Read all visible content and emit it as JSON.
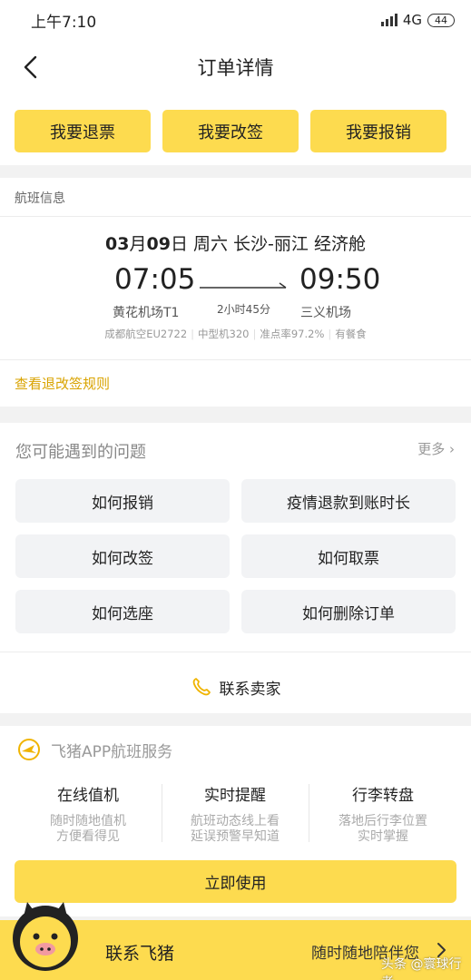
{
  "status_bar": {
    "time": "上午7:10",
    "network": "4G",
    "battery": "44",
    "icons": [
      "signal-icon",
      "battery-icon"
    ]
  },
  "nav": {
    "title": "订单详情",
    "back_icon": "chevron-left-icon"
  },
  "actions": [
    {
      "label": "我要退票"
    },
    {
      "label": "我要改签"
    },
    {
      "label": "我要报销"
    }
  ],
  "flight": {
    "section_label": "航班信息",
    "date_month": "03",
    "month_unit": "月",
    "date_day": "09",
    "day_unit": "日",
    "summary": "周六 长沙-丽江 经济舱",
    "depart_time": "07:05",
    "arrive_time": "09:50",
    "duration": "2小时45分",
    "depart_airport": "黄花机场T1",
    "arrive_airport": "三义机场",
    "meta": [
      "成都航空EU2722",
      "中型机320",
      "准点率97.2%",
      "有餐食"
    ],
    "rules_link": "查看退改签规则"
  },
  "faq": {
    "title": "您可能遇到的问题",
    "more": "更多",
    "items": [
      "如何报销",
      "疫情退款到账时长",
      "如何改签",
      "如何取票",
      "如何选座",
      "如何删除订单"
    ],
    "contact_seller": "联系卖家",
    "contact_icon": "phone-icon"
  },
  "services": {
    "title": "飞猪APP航班服务",
    "logo_icon": "plane-logo-icon",
    "items": [
      {
        "name": "在线值机",
        "desc1": "随时随地值机",
        "desc2": "方便看得见"
      },
      {
        "name": "实时提醒",
        "desc1": "航班动态线上看",
        "desc2": "延误预警早知道"
      },
      {
        "name": "行李转盘",
        "desc1": "落地后行李位置",
        "desc2": "实时掌握"
      }
    ],
    "use_button": "立即使用"
  },
  "bottom": {
    "label": "联系飞猪",
    "sub": "随时随地陪伴您",
    "mascot_icon": "fliggy-mascot-icon",
    "chevron_icon": "chevron-right-icon",
    "watermark": "头条 @寰球行者"
  },
  "colors": {
    "accent_yellow": "#fddb4f",
    "link_gold": "#d9a300",
    "page_bg": "#f2f2f2"
  }
}
